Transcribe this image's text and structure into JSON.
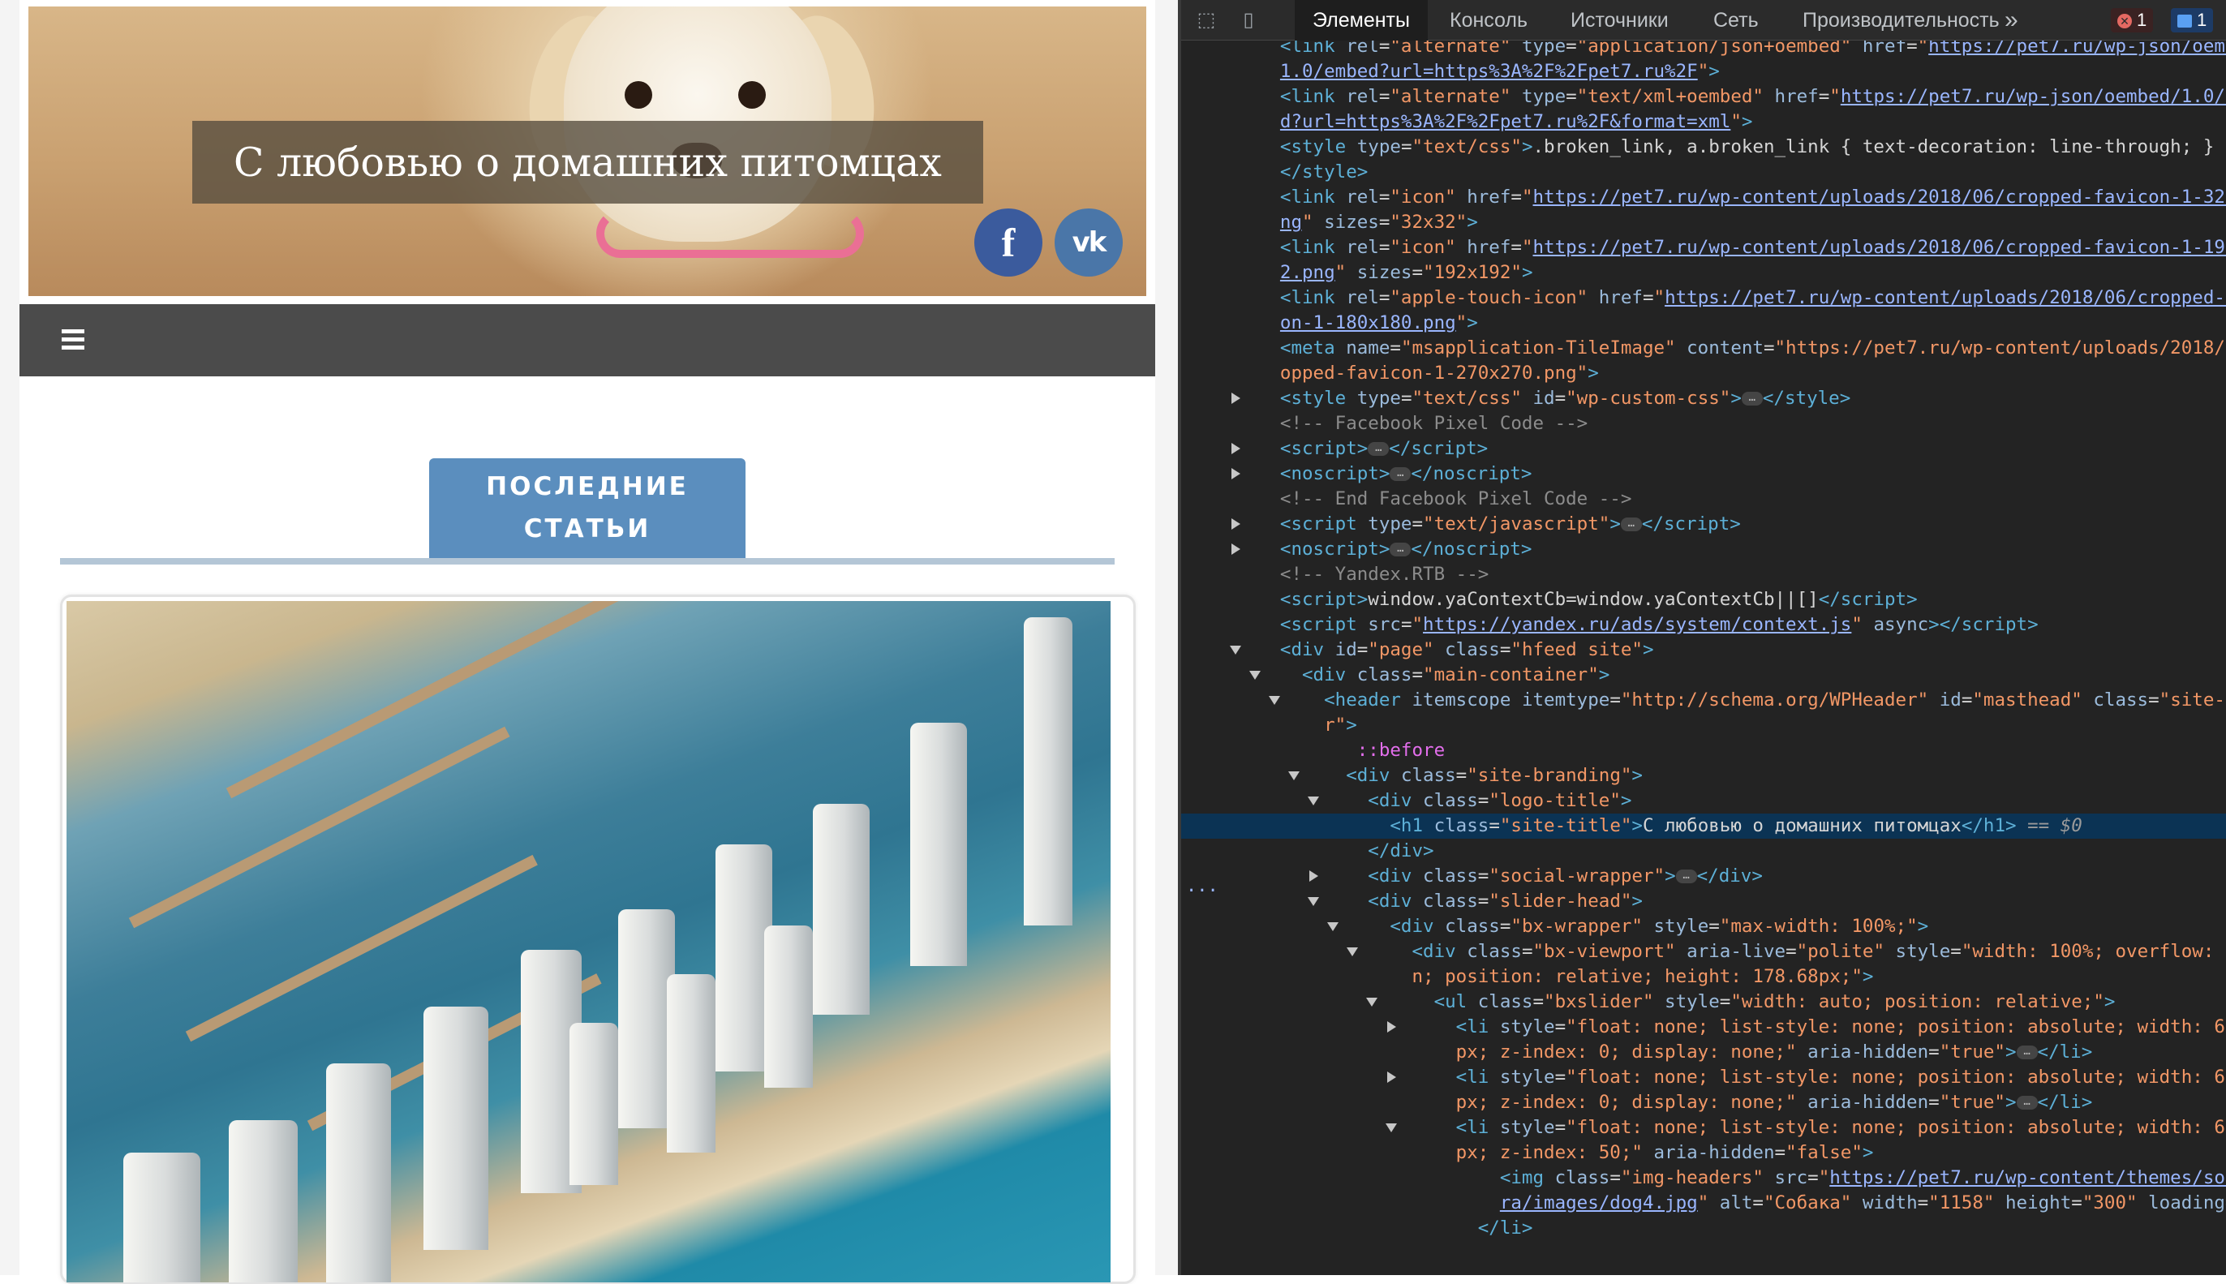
{
  "site": {
    "title": "С любовью о домашних питомцах",
    "social": {
      "facebook": "f",
      "vk": "vk"
    },
    "section_heading": [
      "ПОСЛЕДНИЕ",
      "СТАТЬИ"
    ]
  },
  "devtools": {
    "tabs": [
      "Элементы",
      "Консоль",
      "Источники",
      "Сеть",
      "Производительность"
    ],
    "active_tab": "Элементы",
    "more": "»",
    "errors_count": "1",
    "messages_count": "1",
    "selected_suffix": "== $0"
  },
  "colors": {
    "nav": "#4b4b4b",
    "section_tab": "#5b8ebe",
    "devtools_bg": "#232323",
    "selection": "#0b3354"
  }
}
